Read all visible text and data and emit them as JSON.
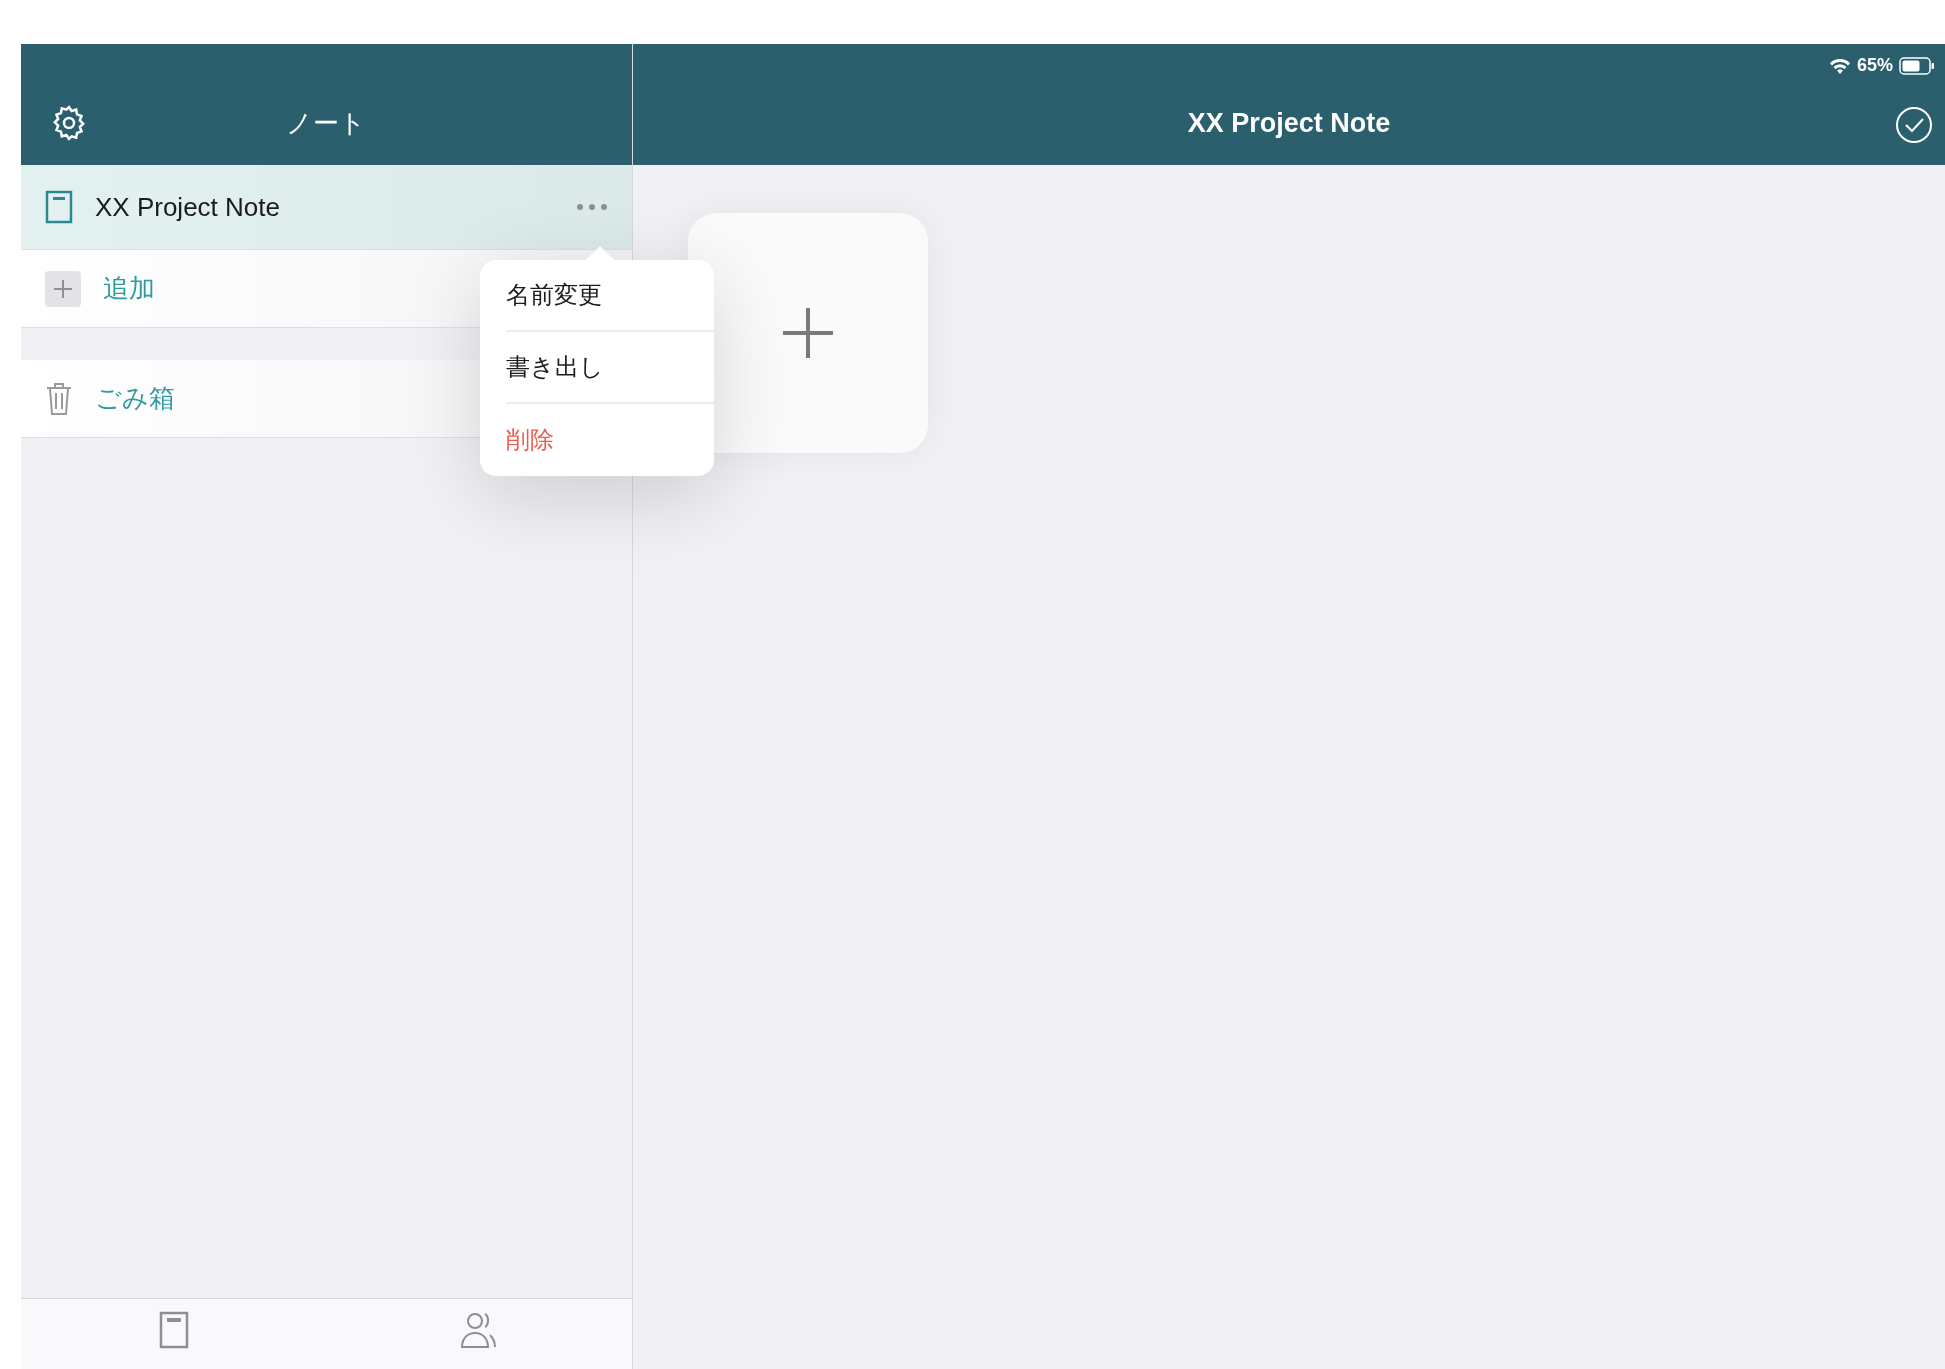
{
  "status_bar": {
    "battery": "65%"
  },
  "sidebar": {
    "title": "ノート",
    "items": [
      {
        "kind": "note",
        "label": "XX Project Note",
        "selected": true
      },
      {
        "kind": "add",
        "label": "追加",
        "selected": false
      },
      {
        "kind": "trash",
        "label": "ごみ箱",
        "selected": false
      }
    ]
  },
  "context_menu": {
    "items": [
      {
        "kind": "normal",
        "label": "名前変更"
      },
      {
        "kind": "normal",
        "label": "書き出し"
      },
      {
        "kind": "destructive",
        "label": "削除"
      }
    ]
  },
  "main": {
    "title": "XX Project Note"
  }
}
